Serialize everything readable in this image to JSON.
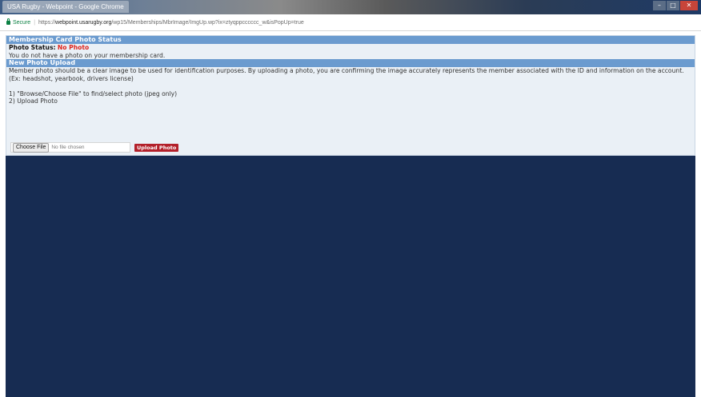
{
  "window": {
    "title": "USA Rugby - Webpoint - Google Chrome",
    "controls": {
      "minimize": "–",
      "maximize": "□",
      "close": "✕"
    }
  },
  "addressbar": {
    "secure_label": "Secure",
    "url_prefix": "https://",
    "url_domain": "webpoint.usarugby.org",
    "url_path": "/wp15/Memberships/MbrImage/ImgUp.wp?ix=ztyqppcccccc_w&isPopUp=true"
  },
  "status_section": {
    "header": "Membership Card Photo Status",
    "status_label": "Photo Status:",
    "status_value": "No Photo",
    "message": "You do not have a photo on your membership card."
  },
  "upload_section": {
    "header": "New Photo Upload",
    "description": "Member photo should be a clear image to be used for identification purposes. By uploading a photo, you are confirming the image accurately represents the member associated with the ID and information on the account.",
    "examples": "(Ex: headshot, yearbook, drivers license)",
    "step1": "1) \"Browse/Choose File\" to find/select photo (jpeg only)",
    "step2": "2) Upload Photo",
    "choose_file_label": "Choose File",
    "no_file_text": "No file chosen",
    "upload_button_label": "Upload Photo"
  },
  "colors": {
    "header_blue": "#6b9bcf",
    "panel_bg": "#eaf0f6",
    "page_bg": "#172c52",
    "status_red": "#e0241b",
    "upload_button": "#b3202a",
    "secure_green": "#0b8043"
  }
}
